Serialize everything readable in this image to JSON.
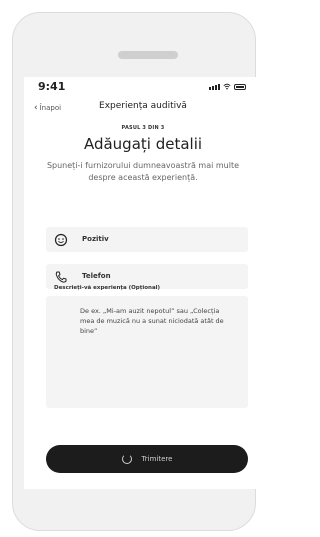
{
  "status": {
    "time": "9:41"
  },
  "nav": {
    "back_label": "Înapoi",
    "title": "Experiența auditivă"
  },
  "step_text": "PASUL 3 DIN 3",
  "title": "Adăugați detalii",
  "subtitle": "Spuneți-i furnizorului dumneavoastră mai multe despre această experiență.",
  "fields": [
    {
      "icon": "smile-icon",
      "label": "Pozitiv"
    },
    {
      "icon": "phone-icon",
      "label": "Telefon"
    }
  ],
  "description": {
    "label": "Descrieți-vă experiența (Opțional)",
    "placeholder": "De ex. „Mi-am auzit nepotul” sau „Colecția mea de muzică nu a sunat niciodată atât de bine”"
  },
  "submit": {
    "label": "Trimitere"
  }
}
